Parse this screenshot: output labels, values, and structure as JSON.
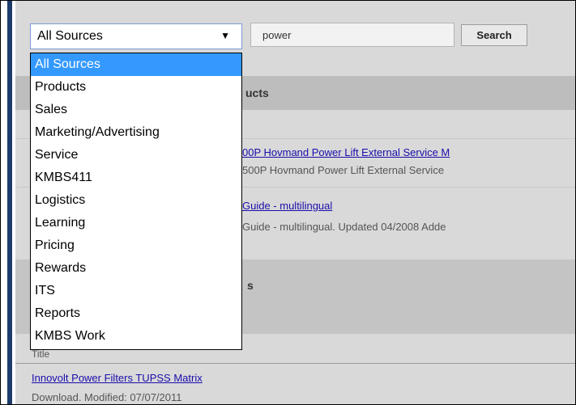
{
  "search": {
    "query": "power",
    "button_label": "Search"
  },
  "source_select": {
    "selected": "All Sources",
    "options": [
      "All Sources",
      "Products",
      "Sales",
      "Marketing/Advertising",
      "Service",
      "KMBS411",
      "Logistics",
      "Learning",
      "Pricing",
      "Rewards",
      "ITS",
      "Reports",
      "KMBS Work"
    ]
  },
  "sections": [
    {
      "header": "ucts"
    },
    {
      "header": "s"
    }
  ],
  "results": [
    {
      "link": "00P Hovmand Power Lift External Service M",
      "desc": "500P Hovmand Power Lift External Service"
    },
    {
      "link": "Guide - multilingual",
      "desc": "Guide - multilingual. Updated 04/2008 Adde"
    },
    {
      "link": "Innovolt Power Filters TUPSS Matrix",
      "desc": "Download. Modified: 07/07/2011"
    }
  ],
  "labels": {
    "title_col": "Title"
  },
  "colors": {
    "accent_bar": "#1d3b6c",
    "selected_option": "#3399ff",
    "link": "#1a0dab"
  }
}
